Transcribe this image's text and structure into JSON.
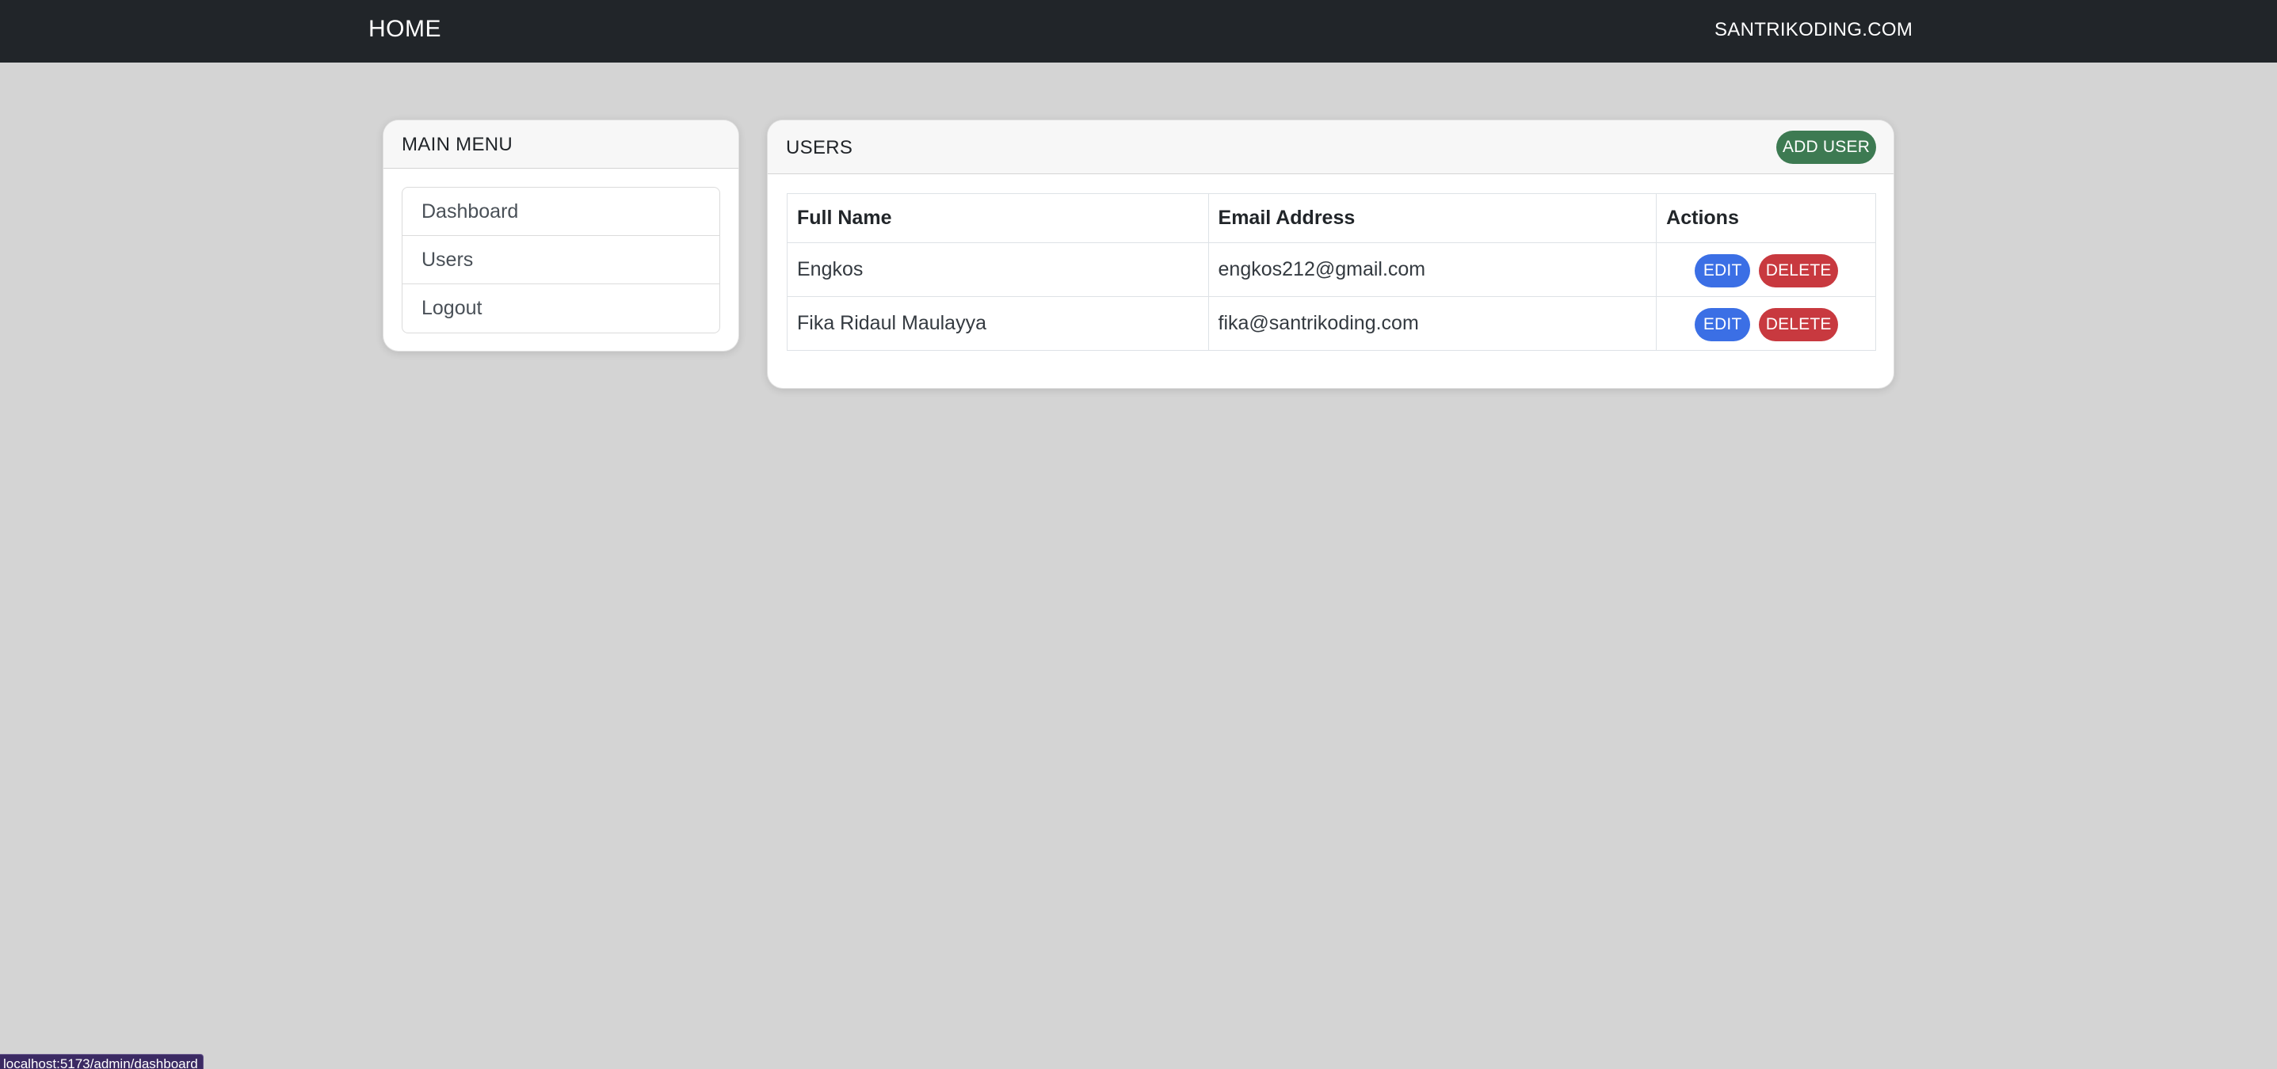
{
  "navbar": {
    "brand": "HOME",
    "right_link": "SANTRIKODING.COM"
  },
  "menu": {
    "title": "MAIN MENU",
    "items": [
      {
        "label": "Dashboard"
      },
      {
        "label": "Users"
      },
      {
        "label": "Logout"
      }
    ]
  },
  "users": {
    "title": "USERS",
    "add_label": "ADD USER",
    "columns": [
      "Full Name",
      "Email Address",
      "Actions"
    ],
    "rows": [
      {
        "name": "Engkos",
        "email": "engkos212@gmail.com",
        "edit": "EDIT",
        "delete": "DELETE"
      },
      {
        "name": "Fika Ridaul Maulayya",
        "email": "fika@santrikoding.com",
        "edit": "EDIT",
        "delete": "DELETE"
      }
    ]
  },
  "status_bar": {
    "url": "localhost:5173/admin/dashboard"
  },
  "colors": {
    "navbar_bg": "#212529",
    "page_bg": "#d4d4d4",
    "add_button": "#3d7a52",
    "edit_button": "#3b6fe5",
    "delete_button": "#c8393f"
  }
}
